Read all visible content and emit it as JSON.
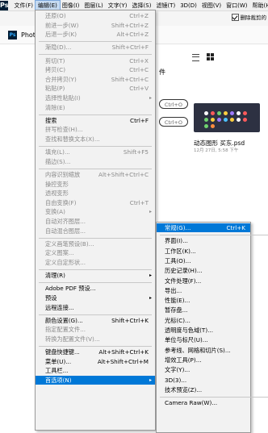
{
  "app": {
    "logo": "Ps",
    "tab_label": "Phot"
  },
  "menubar": [
    {
      "label": "文件(F)"
    },
    {
      "label": "编辑(E)",
      "active": true
    },
    {
      "label": "图像(I)"
    },
    {
      "label": "图层(L)"
    },
    {
      "label": "文字(Y)"
    },
    {
      "label": "选择(S)"
    },
    {
      "label": "滤镜(T)"
    },
    {
      "label": "3D(D)"
    },
    {
      "label": "视图(V)"
    },
    {
      "label": "窗口(W)"
    },
    {
      "label": "帮助(H)"
    }
  ],
  "options": {
    "checkbox_label": "删除裁剪的"
  },
  "home": {
    "recent_label": "件",
    "pill1": "Ctrl+O",
    "pill2": "Ctrl+O",
    "file_name": "动态图形 买东.psd",
    "file_date": "12月 27日, 5:58 下午",
    "thumb_dot_colors": [
      "#ffffff",
      "#ff5a5a",
      "#6fd36f",
      "#ffcf3f",
      "#9f7bff",
      "#ffffff",
      "#ff5a5a",
      "#6fd36f",
      "#ffcf3f",
      "#9f7bff",
      "#4cc3ff",
      "#ffcf3f",
      "#ffffff",
      "#ff5a5a",
      "#6fd36f",
      "#ff8c3f"
    ]
  },
  "edit_menu": {
    "items": [
      {
        "label": "还原(O)",
        "shortcut": "Ctrl+Z",
        "disabled": true
      },
      {
        "label": "前进一步(W)",
        "shortcut": "Shift+Ctrl+Z",
        "disabled": true
      },
      {
        "label": "后退一步(K)",
        "shortcut": "Alt+Ctrl+Z",
        "disabled": true
      },
      {
        "sep": true
      },
      {
        "label": "渐隐(D)...",
        "shortcut": "Shift+Ctrl+F",
        "disabled": true
      },
      {
        "sep": true
      },
      {
        "label": "剪切(T)",
        "shortcut": "Ctrl+X",
        "disabled": true
      },
      {
        "label": "拷贝(C)",
        "shortcut": "Ctrl+C",
        "disabled": true
      },
      {
        "label": "合并拷贝(Y)",
        "shortcut": "Shift+Ctrl+C",
        "disabled": true
      },
      {
        "label": "粘贴(P)",
        "shortcut": "Ctrl+V",
        "disabled": true
      },
      {
        "label": "选择性粘贴(I)",
        "arrow": true,
        "disabled": true
      },
      {
        "label": "清除(E)",
        "disabled": true
      },
      {
        "sep": true
      },
      {
        "label": "搜索",
        "shortcut": "Ctrl+F",
        "disabled": false
      },
      {
        "label": "拼写检查(H)...",
        "disabled": true
      },
      {
        "label": "查找和替换文本(X)...",
        "disabled": true
      },
      {
        "sep": true
      },
      {
        "label": "填充(L)...",
        "shortcut": "Shift+F5",
        "disabled": true
      },
      {
        "label": "描边(S)...",
        "disabled": true
      },
      {
        "sep": true
      },
      {
        "label": "内容识别缩放",
        "shortcut": "Alt+Shift+Ctrl+C",
        "disabled": true
      },
      {
        "label": "操控变形",
        "disabled": true
      },
      {
        "label": "透视变形",
        "disabled": true
      },
      {
        "label": "自由变换(F)",
        "shortcut": "Ctrl+T",
        "disabled": true
      },
      {
        "label": "变换(A)",
        "arrow": true,
        "disabled": true
      },
      {
        "label": "自动对齐图层...",
        "disabled": true
      },
      {
        "label": "自动混合图层...",
        "disabled": true
      },
      {
        "sep": true
      },
      {
        "label": "定义画笔预设(B)...",
        "disabled": true
      },
      {
        "label": "定义图案...",
        "disabled": true
      },
      {
        "label": "定义自定形状...",
        "disabled": true
      },
      {
        "sep": true
      },
      {
        "label": "清理(R)",
        "arrow": true,
        "disabled": false
      },
      {
        "sep": true
      },
      {
        "label": "Adobe PDF 预设...",
        "disabled": false
      },
      {
        "label": "预设",
        "arrow": true,
        "disabled": false
      },
      {
        "label": "远程连接...",
        "disabled": false
      },
      {
        "sep": true
      },
      {
        "label": "颜色设置(G)...",
        "shortcut": "Shift+Ctrl+K",
        "disabled": false
      },
      {
        "label": "指定配置文件...",
        "disabled": true
      },
      {
        "label": "转换为配置文件(V)...",
        "disabled": true
      },
      {
        "sep": true
      },
      {
        "label": "键盘快捷键...",
        "shortcut": "Alt+Shift+Ctrl+K",
        "disabled": false
      },
      {
        "label": "菜单(U)...",
        "shortcut": "Alt+Shift+Ctrl+M",
        "disabled": false
      },
      {
        "label": "工具栏...",
        "disabled": false
      },
      {
        "label": "首选项(N)",
        "arrow": true,
        "selected": true,
        "disabled": false
      }
    ]
  },
  "pref_menu": {
    "items": [
      {
        "label": "常规(G)...",
        "shortcut": "Ctrl+K",
        "selected": true
      },
      {
        "sep": true
      },
      {
        "label": "界面(I)..."
      },
      {
        "label": "工作区(K)..."
      },
      {
        "label": "工具(O)..."
      },
      {
        "label": "历史记录(H)..."
      },
      {
        "label": "文件处理(F)..."
      },
      {
        "label": "导出..."
      },
      {
        "label": "性能(E)..."
      },
      {
        "label": "暂存盘..."
      },
      {
        "label": "光标(C)..."
      },
      {
        "label": "透明度与色域(T)..."
      },
      {
        "label": "单位与标尺(U)..."
      },
      {
        "label": "参考线、网格和切片(S)..."
      },
      {
        "label": "增效工具(P)..."
      },
      {
        "label": "文字(Y)..."
      },
      {
        "label": "3D(3)..."
      },
      {
        "label": "技术预览(Z)..."
      },
      {
        "sep": true
      },
      {
        "label": "Camera Raw(W)..."
      }
    ]
  }
}
